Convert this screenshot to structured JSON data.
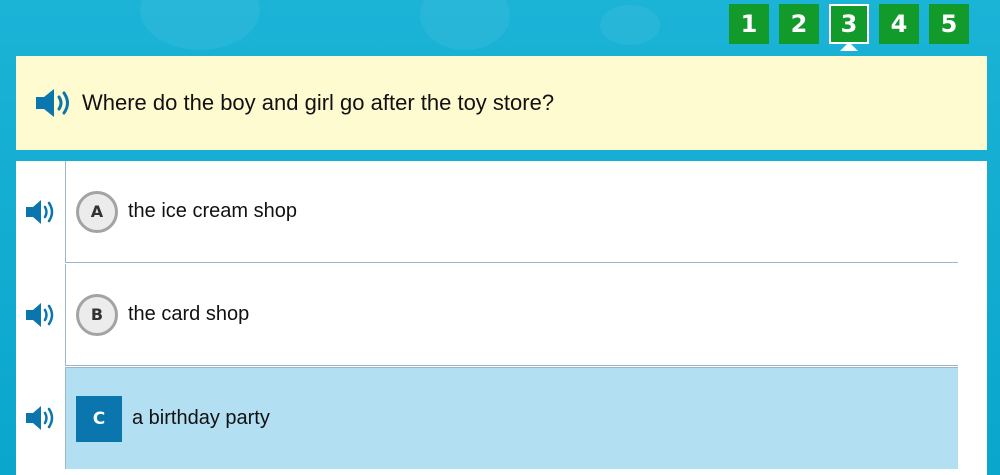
{
  "nav": {
    "questions": [
      {
        "label": "1",
        "current": false
      },
      {
        "label": "2",
        "current": false
      },
      {
        "label": "3",
        "current": true
      },
      {
        "label": "4",
        "current": false
      },
      {
        "label": "5",
        "current": false
      }
    ]
  },
  "question": {
    "text": "Where do the boy and girl go after the toy store?",
    "audio_icon": "speaker-icon"
  },
  "answers": [
    {
      "letter": "A",
      "text": "the ice cream shop",
      "selected": false
    },
    {
      "letter": "B",
      "text": "the card shop",
      "selected": false
    },
    {
      "letter": "C",
      "text": "a birthday party",
      "selected": true
    }
  ],
  "colors": {
    "background": "#0aa6cc",
    "nav_button": "#129a2b",
    "question_panel": "#fffbd0",
    "selected_answer": "#b2dff2",
    "selected_letter": "#0a76ad",
    "speaker": "#0a76ad"
  }
}
